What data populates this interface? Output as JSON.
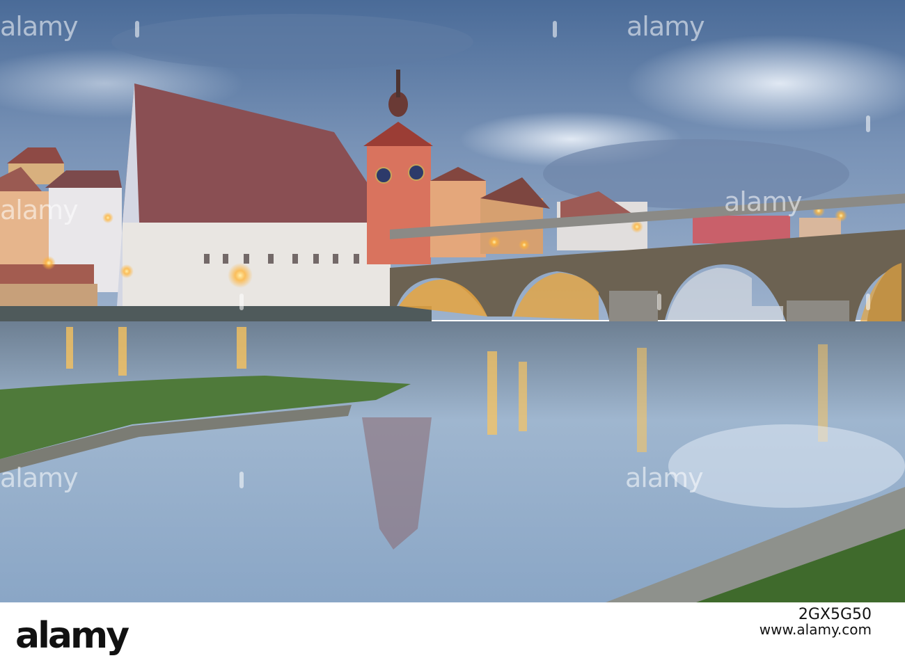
{
  "watermark": {
    "text": "alamy"
  },
  "footer": {
    "brand": "alamy",
    "image_id": "2GX5G50",
    "site": "www.alamy.com"
  },
  "colors": {
    "sky_top": "#4d6f9c",
    "water": "#9fb6cf",
    "lamp_glow": "#ffb43a",
    "tower": "#d9735e"
  }
}
